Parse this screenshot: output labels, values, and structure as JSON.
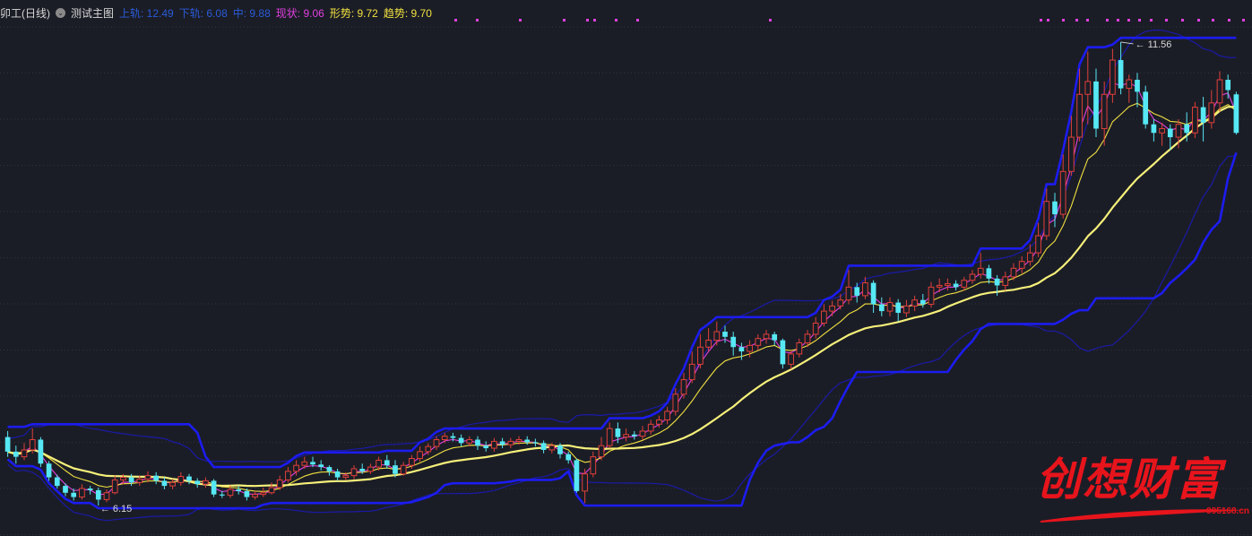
{
  "header": {
    "stock_name": "卯工(日线)",
    "main_chart_name": "测试主图",
    "upper_label": "上轨: 12.49",
    "lower_label": "下轨: 6.08",
    "mid_label": "中: 9.88",
    "status_label": "现状: 9.06",
    "shape_label": "形势: 9.72",
    "trend_label": "趋势: 9.70"
  },
  "watermark": {
    "text": "创想财富",
    "url": "995168.cn"
  },
  "colors": {
    "background": "#1b1d26",
    "grid": "#3a3d4a",
    "up_candle": "#e0403a",
    "down_candle": "#56e8f4",
    "band_bold": "#1c1cf0",
    "band_thin": "#1a1aa8",
    "fast_line": "#e040e0",
    "mid_line": "#f0e040",
    "slow_line": "#f6f07a"
  },
  "chart_data": {
    "type": "candlestick",
    "ylim": [
      5.9,
      11.8
    ],
    "annotations": {
      "high_label": "11.56",
      "low_label": "6.15"
    },
    "candles": [
      [
        6.95,
        6.78,
        7.02,
        6.72
      ],
      [
        6.78,
        6.72,
        6.85,
        6.64
      ],
      [
        6.72,
        6.8,
        6.88,
        6.68
      ],
      [
        6.8,
        6.92,
        7.05,
        6.76
      ],
      [
        6.92,
        6.64,
        6.95,
        6.6
      ],
      [
        6.64,
        6.48,
        6.67,
        6.44
      ],
      [
        6.48,
        6.38,
        6.51,
        6.35
      ],
      [
        6.38,
        6.3,
        6.41,
        6.26
      ],
      [
        6.3,
        6.25,
        6.35,
        6.21
      ],
      [
        6.25,
        6.35,
        6.4,
        6.22
      ],
      [
        6.35,
        6.33,
        6.38,
        6.28
      ],
      [
        6.33,
        6.22,
        6.36,
        6.15
      ],
      [
        6.22,
        6.3,
        6.34,
        6.19
      ],
      [
        6.3,
        6.45,
        6.5,
        6.28
      ],
      [
        6.45,
        6.48,
        6.52,
        6.4
      ],
      [
        6.48,
        6.42,
        6.52,
        6.38
      ],
      [
        6.42,
        6.46,
        6.5,
        6.38
      ],
      [
        6.46,
        6.5,
        6.55,
        6.42
      ],
      [
        6.5,
        6.44,
        6.54,
        6.4
      ],
      [
        6.44,
        6.38,
        6.48,
        6.34
      ],
      [
        6.38,
        6.42,
        6.46,
        6.34
      ],
      [
        6.42,
        6.49,
        6.54,
        6.38
      ],
      [
        6.49,
        6.44,
        6.52,
        6.4
      ],
      [
        6.44,
        6.4,
        6.47,
        6.36
      ],
      [
        6.4,
        6.44,
        6.48,
        6.36
      ],
      [
        6.44,
        6.28,
        6.46,
        6.25
      ],
      [
        6.28,
        6.27,
        6.32,
        6.24
      ],
      [
        6.27,
        6.34,
        6.38,
        6.24
      ],
      [
        6.34,
        6.32,
        6.38,
        6.28
      ],
      [
        6.32,
        6.25,
        6.35,
        6.21
      ],
      [
        6.25,
        6.28,
        6.32,
        6.22
      ],
      [
        6.28,
        6.3,
        6.36,
        6.25
      ],
      [
        6.3,
        6.36,
        6.42,
        6.28
      ],
      [
        6.36,
        6.45,
        6.5,
        6.33
      ],
      [
        6.45,
        6.55,
        6.6,
        6.42
      ],
      [
        6.55,
        6.62,
        6.68,
        6.5
      ],
      [
        6.62,
        6.66,
        6.72,
        6.58
      ],
      [
        6.66,
        6.63,
        6.72,
        6.6
      ],
      [
        6.63,
        6.6,
        6.68,
        6.56
      ],
      [
        6.6,
        6.55,
        6.62,
        6.5
      ],
      [
        6.55,
        6.48,
        6.58,
        6.44
      ],
      [
        6.48,
        6.5,
        6.54,
        6.45
      ],
      [
        6.5,
        6.58,
        6.62,
        6.46
      ],
      [
        6.58,
        6.55,
        6.64,
        6.52
      ],
      [
        6.55,
        6.6,
        6.64,
        6.52
      ],
      [
        6.6,
        6.68,
        6.72,
        6.56
      ],
      [
        6.68,
        6.62,
        6.74,
        6.58
      ],
      [
        6.62,
        6.52,
        6.68,
        6.48
      ],
      [
        6.52,
        6.62,
        6.66,
        6.5
      ],
      [
        6.62,
        6.7,
        6.74,
        6.58
      ],
      [
        6.7,
        6.78,
        6.84,
        6.66
      ],
      [
        6.78,
        6.84,
        6.88,
        6.74
      ],
      [
        6.84,
        6.92,
        6.96,
        6.8
      ],
      [
        6.92,
        6.96,
        7.0,
        6.88
      ],
      [
        6.96,
        6.94,
        7.0,
        6.9
      ],
      [
        6.94,
        6.88,
        6.98,
        6.84
      ],
      [
        6.88,
        6.92,
        6.96,
        6.84
      ],
      [
        6.92,
        6.85,
        6.96,
        6.8
      ],
      [
        6.85,
        6.82,
        6.9,
        6.78
      ],
      [
        6.82,
        6.9,
        6.94,
        6.78
      ],
      [
        6.9,
        6.86,
        6.94,
        6.82
      ],
      [
        6.86,
        6.9,
        6.94,
        6.82
      ],
      [
        6.9,
        6.92,
        6.96,
        6.86
      ],
      [
        6.92,
        6.89,
        6.96,
        6.86
      ],
      [
        6.89,
        6.88,
        6.93,
        6.84
      ],
      [
        6.88,
        6.8,
        6.91,
        6.76
      ],
      [
        6.8,
        6.85,
        6.88,
        6.76
      ],
      [
        6.85,
        6.75,
        6.88,
        6.7
      ],
      [
        6.75,
        6.68,
        6.78,
        6.64
      ],
      [
        6.68,
        6.32,
        6.7,
        6.3
      ],
      [
        6.32,
        6.52,
        6.58,
        6.18
      ],
      [
        6.52,
        6.72,
        6.78,
        6.48
      ],
      [
        6.72,
        6.85,
        6.95,
        6.68
      ],
      [
        6.85,
        7.05,
        7.12,
        6.82
      ],
      [
        7.05,
        6.95,
        7.12,
        6.88
      ],
      [
        6.95,
        6.98,
        7.05,
        6.9
      ],
      [
        6.98,
        6.96,
        7.02,
        6.92
      ],
      [
        6.96,
        7.02,
        7.08,
        6.92
      ],
      [
        7.02,
        7.1,
        7.15,
        6.98
      ],
      [
        7.1,
        7.15,
        7.2,
        7.06
      ],
      [
        7.15,
        7.25,
        7.3,
        7.1
      ],
      [
        7.25,
        7.45,
        7.52,
        7.2
      ],
      [
        7.45,
        7.62,
        7.7,
        7.4
      ],
      [
        7.62,
        7.8,
        7.95,
        7.58
      ],
      [
        7.8,
        8.0,
        8.15,
        7.75
      ],
      [
        8.0,
        8.08,
        8.22,
        7.95
      ],
      [
        8.08,
        8.18,
        8.3,
        8.02
      ],
      [
        8.18,
        8.12,
        8.25,
        8.05
      ],
      [
        8.12,
        8.0,
        8.18,
        7.9
      ],
      [
        8.0,
        7.95,
        8.05,
        7.85
      ],
      [
        7.95,
        8.02,
        8.08,
        7.88
      ],
      [
        8.02,
        8.1,
        8.15,
        7.96
      ],
      [
        8.1,
        8.15,
        8.2,
        8.04
      ],
      [
        8.15,
        8.08,
        8.18,
        8.02
      ],
      [
        8.08,
        7.8,
        8.1,
        7.75
      ],
      [
        7.8,
        7.92,
        7.96,
        7.74
      ],
      [
        7.92,
        8.05,
        8.1,
        7.88
      ],
      [
        8.05,
        8.15,
        8.2,
        8.0
      ],
      [
        8.15,
        8.28,
        8.35,
        8.1
      ],
      [
        8.28,
        8.42,
        8.5,
        8.24
      ],
      [
        8.42,
        8.48,
        8.54,
        8.36
      ],
      [
        8.48,
        8.55,
        8.62,
        8.44
      ],
      [
        8.55,
        8.7,
        8.9,
        8.5
      ],
      [
        8.7,
        8.6,
        8.75,
        8.52
      ],
      [
        8.6,
        8.75,
        8.82,
        8.56
      ],
      [
        8.75,
        8.5,
        8.78,
        8.4
      ],
      [
        8.5,
        8.42,
        8.58,
        8.36
      ],
      [
        8.42,
        8.52,
        8.58,
        8.36
      ],
      [
        8.52,
        8.4,
        8.56,
        8.3
      ],
      [
        8.4,
        8.48,
        8.55,
        8.35
      ],
      [
        8.48,
        8.55,
        8.6,
        8.42
      ],
      [
        8.55,
        8.5,
        8.62,
        8.46
      ],
      [
        8.5,
        8.7,
        8.76,
        8.46
      ],
      [
        8.7,
        8.72,
        8.8,
        8.64
      ],
      [
        8.72,
        8.74,
        8.8,
        8.66
      ],
      [
        8.74,
        8.7,
        8.78,
        8.66
      ],
      [
        8.7,
        8.78,
        8.82,
        8.66
      ],
      [
        8.78,
        8.85,
        8.9,
        8.74
      ],
      [
        8.85,
        8.92,
        9.1,
        8.8
      ],
      [
        8.92,
        8.8,
        8.96,
        8.74
      ],
      [
        8.8,
        8.72,
        8.84,
        8.6
      ],
      [
        8.72,
        8.82,
        8.88,
        8.66
      ],
      [
        8.82,
        8.92,
        8.98,
        8.78
      ],
      [
        8.92,
        9.0,
        9.06,
        8.86
      ],
      [
        9.0,
        9.1,
        9.2,
        8.95
      ],
      [
        9.1,
        9.3,
        9.45,
        9.05
      ],
      [
        9.3,
        9.7,
        9.85,
        9.25
      ],
      [
        9.7,
        9.55,
        9.8,
        9.4
      ],
      [
        9.55,
        10.05,
        10.25,
        9.5
      ],
      [
        10.05,
        10.45,
        10.7,
        10.0
      ],
      [
        10.45,
        10.95,
        11.25,
        10.4
      ],
      [
        10.95,
        11.1,
        11.45,
        10.6
      ],
      [
        11.1,
        10.55,
        11.25,
        10.45
      ],
      [
        10.55,
        10.95,
        11.1,
        10.35
      ],
      [
        10.95,
        11.35,
        11.48,
        10.85
      ],
      [
        11.35,
        11.02,
        11.56,
        10.95
      ],
      [
        11.02,
        11.12,
        11.18,
        10.85
      ],
      [
        11.12,
        10.98,
        11.2,
        10.8
      ],
      [
        10.98,
        10.6,
        11.05,
        10.55
      ],
      [
        10.6,
        10.5,
        10.66,
        10.4
      ],
      [
        10.5,
        10.55,
        10.62,
        10.35
      ],
      [
        10.55,
        10.45,
        10.6,
        10.3
      ],
      [
        10.45,
        10.6,
        10.66,
        10.32
      ],
      [
        10.6,
        10.5,
        10.74,
        10.4
      ],
      [
        10.5,
        10.8,
        10.86,
        10.44
      ],
      [
        10.8,
        10.62,
        10.92,
        10.4
      ],
      [
        10.62,
        10.85,
        11.0,
        10.55
      ],
      [
        10.85,
        11.12,
        11.22,
        10.75
      ],
      [
        11.12,
        11.0,
        11.18,
        10.9
      ],
      [
        10.95,
        10.5,
        10.98,
        10.48
      ]
    ]
  }
}
